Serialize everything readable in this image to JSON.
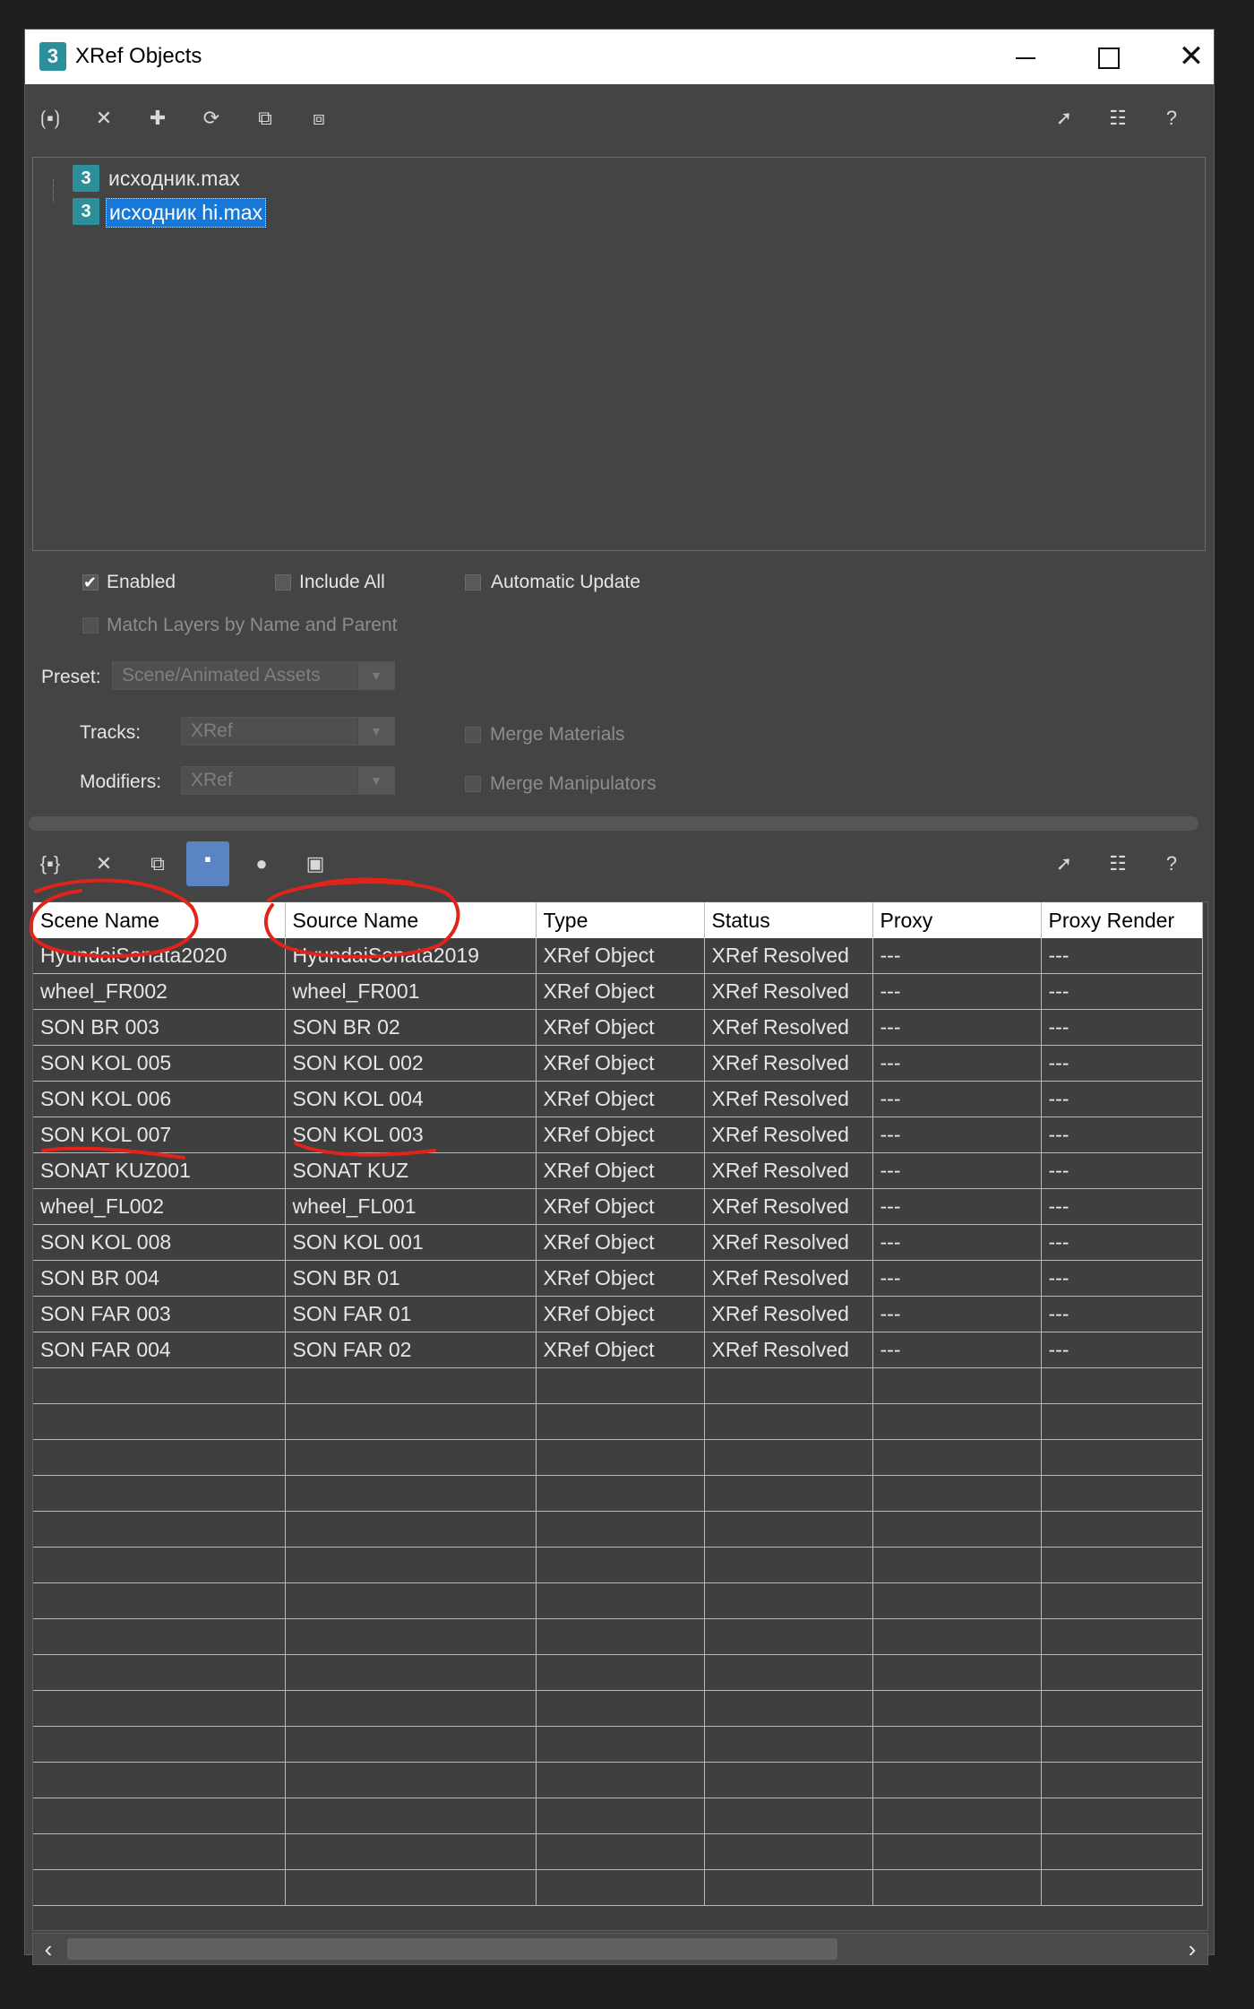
{
  "window": {
    "title": "XRef Objects",
    "icon_glyph": "3",
    "controls": {
      "minimize": "minimize-icon",
      "maximize": "maximize-icon",
      "close": "close-icon"
    }
  },
  "top_toolbar": {
    "left_icons": [
      "xref-file-icon",
      "remove-icon",
      "add-icon",
      "refresh-icon",
      "merge-icon",
      "convert-icon"
    ],
    "right_icons": [
      "select-icon",
      "select-in-list-icon",
      "help-icon"
    ]
  },
  "file_tree": {
    "items": [
      {
        "label": "исходник.max",
        "selected": false
      },
      {
        "label": "исходник hi.max",
        "selected": true
      }
    ]
  },
  "options": {
    "enabled": {
      "label": "Enabled",
      "checked": true
    },
    "include_all": {
      "label": "Include All",
      "checked": false
    },
    "automatic_update": {
      "label": "Automatic Update",
      "checked": false
    },
    "match_layers": {
      "label": "Match Layers by Name and Parent",
      "checked": false,
      "disabled": true
    },
    "preset_label": "Preset:",
    "preset_value": "Scene/Animated Assets",
    "tracks_label": "Tracks:",
    "tracks_value": "XRef",
    "modifiers_label": "Modifiers:",
    "modifiers_value": "XRef",
    "merge_materials": {
      "label": "Merge Materials",
      "disabled": true
    },
    "merge_manipulators": {
      "label": "Merge Manipulators",
      "disabled": true
    }
  },
  "entity_toolbar": {
    "left_icons": [
      "xref-entity-icon",
      "remove-icon",
      "merge-icon",
      "filter-objects-icon",
      "dot-icon",
      "image-icon"
    ],
    "right_icons": [
      "select-icon",
      "select-in-list-icon",
      "help-icon"
    ],
    "accent": "#5b84c4"
  },
  "table": {
    "columns": [
      "Scene Name",
      "Source Name",
      "Type",
      "Status",
      "Proxy",
      "Proxy Render"
    ],
    "rows": [
      [
        "HyundaiSonata2020",
        "HyundaiSonata2019",
        "XRef Object",
        "XRef Resolved",
        "---",
        "---"
      ],
      [
        "wheel_FR002",
        "wheel_FR001",
        "XRef Object",
        "XRef Resolved",
        "---",
        "---"
      ],
      [
        "SON BR 003",
        "SON BR 02",
        "XRef Object",
        "XRef Resolved",
        "---",
        "---"
      ],
      [
        "SON KOL 005",
        "SON KOL 002",
        "XRef Object",
        "XRef Resolved",
        "---",
        "---"
      ],
      [
        "SON KOL 006",
        "SON KOL 004",
        "XRef Object",
        "XRef Resolved",
        "---",
        "---"
      ],
      [
        "SON KOL 007",
        "SON KOL 003",
        "XRef Object",
        "XRef Resolved",
        "---",
        "---"
      ],
      [
        "SONAT KUZ001",
        "SONAT KUZ",
        "XRef Object",
        "XRef Resolved",
        "---",
        "---"
      ],
      [
        "wheel_FL002",
        "wheel_FL001",
        "XRef Object",
        "XRef Resolved",
        "---",
        "---"
      ],
      [
        "SON KOL 008",
        "SON KOL 001",
        "XRef Object",
        "XRef Resolved",
        "---",
        "---"
      ],
      [
        "SON BR 004",
        "SON BR 01",
        "XRef Object",
        "XRef Resolved",
        "---",
        "---"
      ],
      [
        "SON FAR 003",
        "SON FAR 01",
        "XRef Object",
        "XRef Resolved",
        "---",
        "---"
      ],
      [
        "SON FAR 004",
        "SON FAR 02",
        "XRef Object",
        "XRef Resolved",
        "---",
        "---"
      ]
    ],
    "empty_rows": 15
  },
  "annotation_color": "#e0241b"
}
